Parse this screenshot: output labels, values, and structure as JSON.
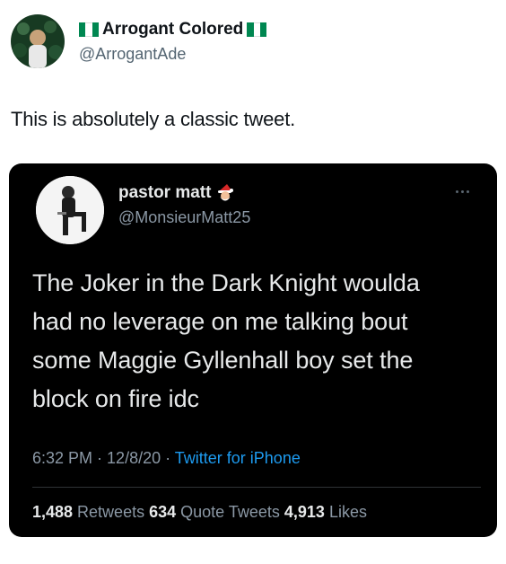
{
  "outer_tweet": {
    "avatar_icon": "profile-photo-green-crowd",
    "display_name": "Arrogant Colored",
    "flag_icon": "nigeria-flag-icon",
    "flag_colors": [
      "#008751",
      "#ffffff",
      "#008751"
    ],
    "handle": "@ArrogantAde",
    "text": "This is absolutely a classic tweet."
  },
  "embedded_tweet": {
    "avatar_icon": "profile-photo-person-seated",
    "display_name": "pastor matt",
    "name_emoji": "santa-emoji",
    "handle": "@MonsieurMatt25",
    "more_icon": "more-options-icon",
    "body": "The Joker in the Dark Knight woulda\nhad no leverage on me talking bout\nsome Maggie Gyllenhall boy set the\nblock on fire idc",
    "time": "6:32 PM",
    "sep1": " · ",
    "date": "12/8/20",
    "sep2": " · ",
    "source": "Twitter for iPhone",
    "retweets_count": "1,488",
    "retweets_label": " Retweets ",
    "quotes_count": "634",
    "quotes_label": " Quote Tweets ",
    "likes_count": "4,913",
    "likes_label": " Likes"
  },
  "colors": {
    "embed_bg": "#000000",
    "link_blue": "#1d9bf0",
    "secondary_text": "#8b98a5"
  }
}
